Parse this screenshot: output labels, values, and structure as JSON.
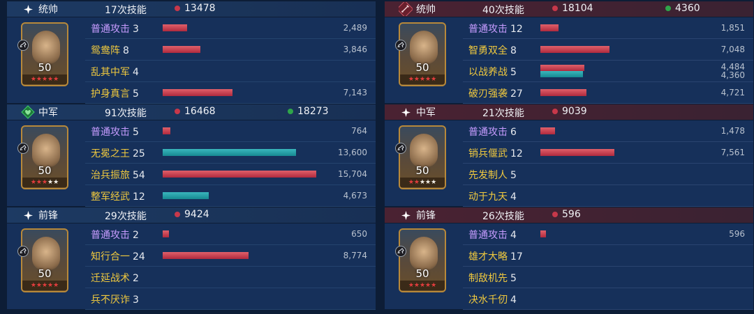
{
  "left": [
    {
      "role": "统帅",
      "role_icon": "star-icon",
      "skills": "17次技能",
      "damage": "13478",
      "heal": "",
      "level": "50",
      "rows": [
        {
          "name": "普通攻击",
          "count": "3",
          "type": "normal",
          "value": "2,489",
          "bars": [
            {
              "color": "red",
              "pct": 0.158
            }
          ]
        },
        {
          "name": "鸳鸯阵",
          "count": "8",
          "type": "skill",
          "value": "3,846",
          "bars": [
            {
              "color": "red",
              "pct": 0.245
            }
          ]
        },
        {
          "name": "乱其中军",
          "count": "4",
          "type": "skill",
          "value": "",
          "bars": []
        },
        {
          "name": "护身真言",
          "count": "5",
          "type": "skill",
          "value": "7,143",
          "bars": [
            {
              "color": "red",
              "pct": 0.455
            }
          ]
        }
      ]
    },
    {
      "role": "中军",
      "role_icon": "heart-icon",
      "skills": "91次技能",
      "damage": "16468",
      "heal": "18273",
      "level": "50",
      "rows": [
        {
          "name": "普通攻击",
          "count": "5",
          "type": "normal",
          "value": "764",
          "bars": [
            {
              "color": "red",
              "pct": 0.049
            }
          ]
        },
        {
          "name": "无冕之王",
          "count": "25",
          "type": "skill",
          "value": "13,600",
          "bars": [
            {
              "color": "teal",
              "pct": 0.866
            }
          ]
        },
        {
          "name": "治兵振旅",
          "count": "54",
          "type": "skill",
          "value": "15,704",
          "bars": [
            {
              "color": "red",
              "pct": 1.0
            }
          ]
        },
        {
          "name": "整军经武",
          "count": "12",
          "type": "skill",
          "value": "4,673",
          "bars": [
            {
              "color": "teal",
              "pct": 0.298
            }
          ]
        }
      ]
    },
    {
      "role": "前锋",
      "role_icon": "star-icon",
      "skills": "29次技能",
      "damage": "9424",
      "heal": "",
      "level": "50",
      "rows": [
        {
          "name": "普通攻击",
          "count": "2",
          "type": "normal",
          "value": "650",
          "bars": [
            {
              "color": "red",
              "pct": 0.041
            }
          ]
        },
        {
          "name": "知行合一",
          "count": "24",
          "type": "skill",
          "value": "8,774",
          "bars": [
            {
              "color": "red",
              "pct": 0.559
            }
          ]
        },
        {
          "name": "迁延战术",
          "count": "2",
          "type": "skill",
          "value": "",
          "bars": []
        },
        {
          "name": "兵不厌诈",
          "count": "3",
          "type": "skill",
          "value": "",
          "bars": []
        }
      ]
    }
  ],
  "right": [
    {
      "role": "统帅",
      "role_icon": "sword-icon",
      "skills": "40次技能",
      "damage": "18104",
      "heal": "4360",
      "level": "50",
      "rows": [
        {
          "name": "普通攻击",
          "count": "12",
          "type": "normal",
          "value": "1,851",
          "bars": [
            {
              "color": "red",
              "pct": 0.118
            }
          ]
        },
        {
          "name": "智勇双全",
          "count": "8",
          "type": "skill",
          "value": "7,048",
          "bars": [
            {
              "color": "red",
              "pct": 0.449
            }
          ]
        },
        {
          "name": "以战养战",
          "count": "5",
          "type": "skill",
          "value": "4,484",
          "value2": "4,360",
          "bars": [
            {
              "color": "red",
              "pct": 0.286
            },
            {
              "color": "teal",
              "pct": 0.278
            }
          ]
        },
        {
          "name": "破刃强袭",
          "count": "27",
          "type": "skill",
          "value": "4,721",
          "bars": [
            {
              "color": "red",
              "pct": 0.301
            }
          ]
        }
      ]
    },
    {
      "role": "中军",
      "role_icon": "star-icon",
      "skills": "21次技能",
      "damage": "9039",
      "heal": "",
      "level": "50",
      "rows": [
        {
          "name": "普通攻击",
          "count": "6",
          "type": "normal",
          "value": "1,478",
          "bars": [
            {
              "color": "red",
              "pct": 0.094
            }
          ]
        },
        {
          "name": "销兵偃武",
          "count": "12",
          "type": "skill",
          "value": "7,561",
          "bars": [
            {
              "color": "red",
              "pct": 0.481
            }
          ]
        },
        {
          "name": "先发制人",
          "count": "5",
          "type": "skill",
          "value": "",
          "bars": []
        },
        {
          "name": "动于九天",
          "count": "4",
          "type": "skill",
          "value": "",
          "bars": []
        }
      ]
    },
    {
      "role": "前锋",
      "role_icon": "star-icon",
      "skills": "26次技能",
      "damage": "596",
      "heal": "",
      "level": "50",
      "rows": [
        {
          "name": "普通攻击",
          "count": "4",
          "type": "normal",
          "value": "596",
          "bars": [
            {
              "color": "red",
              "pct": 0.038
            }
          ]
        },
        {
          "name": "雄才大略",
          "count": "17",
          "type": "skill",
          "value": "",
          "bars": []
        },
        {
          "name": "制敌机先",
          "count": "5",
          "type": "skill",
          "value": "",
          "bars": []
        },
        {
          "name": "决水千仞",
          "count": "4",
          "type": "skill",
          "value": "",
          "bars": []
        }
      ]
    }
  ],
  "colors": {
    "bar_red": "#c7384a",
    "bar_teal": "#1e9ea6",
    "skill_name": "#f0c93e",
    "normal_attack": "#c79cff",
    "dot_red": "#c7384a",
    "dot_green": "#2fa54a"
  },
  "stars": [
    {
      "red": 5,
      "white": 0
    },
    {
      "red": 3,
      "white": 2
    },
    {
      "red": 5,
      "white": 0
    },
    {
      "red": 5,
      "white": 0
    },
    {
      "red": 2,
      "white": 3
    },
    {
      "red": 5,
      "white": 0
    }
  ]
}
